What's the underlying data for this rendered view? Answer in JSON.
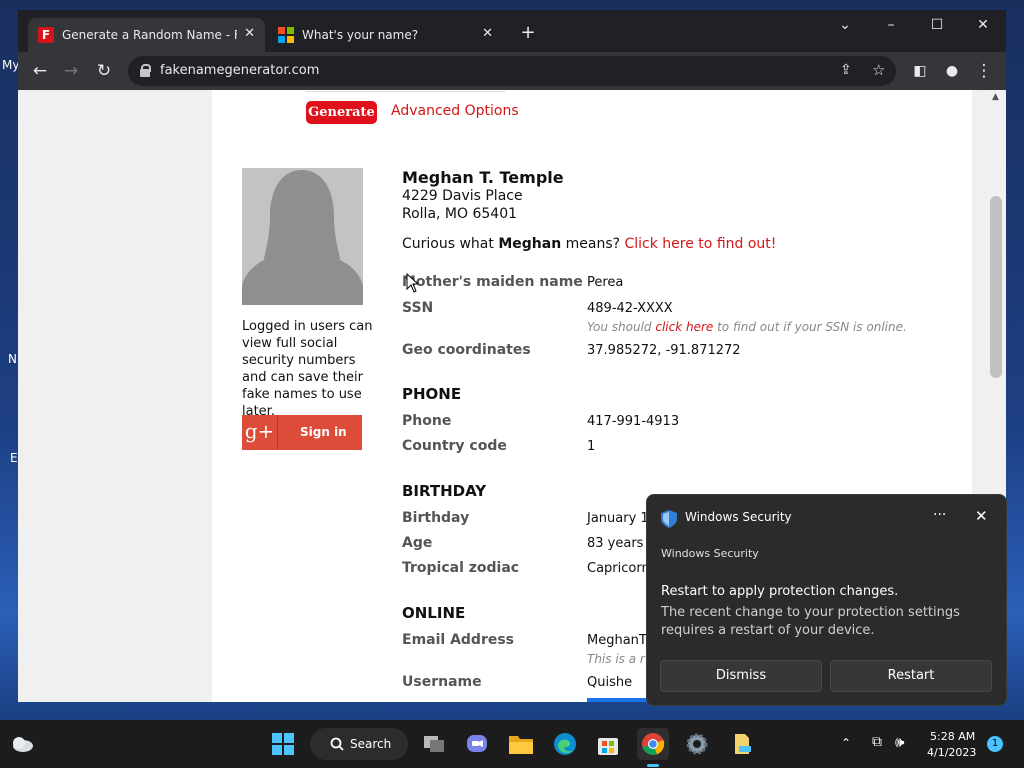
{
  "browser": {
    "tabs": [
      {
        "title": "Generate a Random Name - Fake",
        "favicon": "fake-name-generator-favicon"
      },
      {
        "title": "What's your name?",
        "favicon": "microsoft-favicon"
      }
    ],
    "new_tab": "+",
    "url": "fakenamegenerator.com",
    "controls": {
      "down": "⌄",
      "minimize": "–",
      "maximize": "☐",
      "close": "✕"
    }
  },
  "desktop": {
    "labels": [
      "My",
      "N",
      "E"
    ]
  },
  "page": {
    "generate_label": "Generate",
    "advanced_options": "Advanced Options",
    "login_note": "Logged in users can view full social security numbers and can save their fake names to use later.",
    "signin": {
      "icon_text": "g+",
      "label": "Sign in"
    },
    "person": {
      "name": "Meghan T. Temple",
      "address_line1": "4229 Davis Place",
      "address_line2": "Rolla, MO 65401"
    },
    "curious": {
      "prefix": "Curious what ",
      "first": "Meghan",
      "middle": " means? ",
      "link": "Click here to find out!"
    },
    "fields": [
      {
        "label": "Mother's maiden name",
        "value": "Perea"
      },
      {
        "label": "SSN",
        "value": "489-42-XXXX"
      },
      {
        "label": "Geo coordinates",
        "value": "37.985272, -91.871272"
      }
    ],
    "ssn_note": {
      "prefix": "You should ",
      "link": "click here",
      "suffix": " to find out if your SSN is online."
    },
    "phone": {
      "heading": "PHONE",
      "fields": [
        {
          "label": "Phone",
          "value": "417-991-4913"
        },
        {
          "label": "Country code",
          "value": "1"
        }
      ]
    },
    "birthday": {
      "heading": "BIRTHDAY",
      "fields": [
        {
          "label": "Birthday",
          "value": "January 1"
        },
        {
          "label": "Age",
          "value": "83 years"
        },
        {
          "label": "Tropical zodiac",
          "value": "Capricorn"
        }
      ]
    },
    "online": {
      "heading": "ONLINE",
      "fields": [
        {
          "label": "Email Address",
          "value": "MeghanT"
        },
        {
          "label": "Username",
          "value": "Quishe"
        }
      ],
      "email_note": "This is a r"
    }
  },
  "toast": {
    "title": "Windows Security",
    "app_name": "Windows Security",
    "heading": "Restart to apply protection changes.",
    "message": "The recent change to your protection settings requires a restart of your device.",
    "dismiss": "Dismiss",
    "restart": "Restart",
    "more": "···",
    "close": "✕"
  },
  "taskbar": {
    "search_label": "Search",
    "time": "5:28 AM",
    "date": "4/1/2023",
    "notification_count": "1"
  },
  "colors": {
    "link_red": "#d41616",
    "generate_red": "#e0101a",
    "google_red": "#dd4b39",
    "windows_blue": "#1a73e8"
  }
}
